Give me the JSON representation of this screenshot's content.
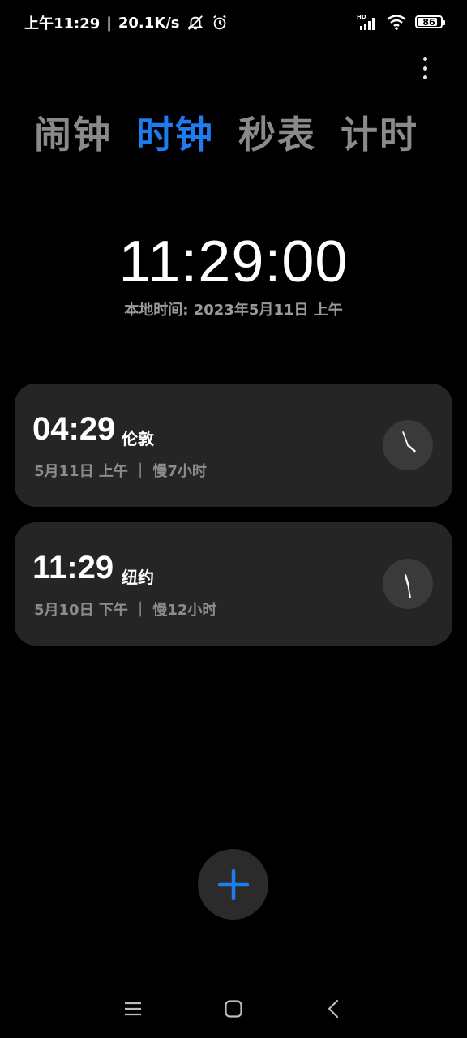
{
  "status_bar": {
    "time": "上午11:29",
    "separator": "|",
    "net_speed": "20.1K/s",
    "icons": [
      "mute-icon",
      "alarm-icon",
      "hd-signal-icon",
      "wifi-icon",
      "battery-icon"
    ],
    "battery_level": "86",
    "battery_fraction": 0.86
  },
  "tabs": [
    {
      "label": "闹钟",
      "active": false
    },
    {
      "label": "时钟",
      "active": true
    },
    {
      "label": "秒表",
      "active": false
    },
    {
      "label": "计时",
      "active": false
    }
  ],
  "clock": {
    "time": "11:29:00",
    "local_date": "本地时间: 2023年5月11日 上午"
  },
  "cities": [
    {
      "time": "04:29",
      "name": "伦敦",
      "meta": "5月11日 上午 ｜ 慢7小时",
      "hour_hand_deg": 130,
      "minute_hand_deg": -20
    },
    {
      "time": "11:29",
      "name": "纽约",
      "meta": "5月10日 下午 ｜ 慢12小时",
      "hour_hand_deg": -15,
      "minute_hand_deg": 170
    }
  ],
  "colors": {
    "accent": "#1f7cf0",
    "background": "#000000",
    "card": "#252525",
    "tab_inactive": "#8a8a8a"
  },
  "icons": {
    "menu": "more-vert-icon",
    "add": "plus-icon",
    "nav": [
      "menu-icon",
      "home-icon",
      "back-icon"
    ]
  }
}
